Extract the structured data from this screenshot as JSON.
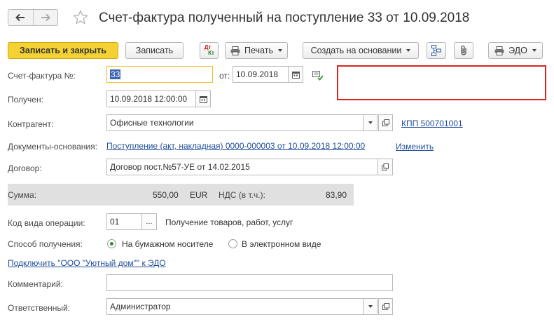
{
  "header": {
    "title": "Счет-фактура полученный на поступление 33 от 10.09.2018"
  },
  "toolbar": {
    "save_close_label": "Записать и закрыть",
    "save_label": "Записать",
    "dtkt_top": "Дт",
    "dtkt_bottom": "Кт",
    "print_label": "Печать",
    "create_based_label": "Создать на основании",
    "edo_label": "ЭДО"
  },
  "form": {
    "invoice_number_label": "Счет-фактура №:",
    "invoice_number_value": "33",
    "from_label": "от:",
    "invoice_date_value": "10.09.2018",
    "received_label": "Получен:",
    "received_value": "10.09.2018 12:00:00",
    "counterparty_label": "Контрагент:",
    "counterparty_value": "Офисные технологии",
    "kpp_link": "КПП 500701001",
    "base_docs_label": "Документы-основания:",
    "base_docs_link": "Поступление (акт, накладная) 0000-000003 от 10.09.2018 12:00:00",
    "change_link": "Изменить",
    "contract_label": "Договор:",
    "contract_value": "Договор пост.№57-УЕ от 14.02.2015",
    "sum_label": "Сумма:",
    "sum_value": "550,00",
    "currency": "EUR",
    "vat_label": "НДС (в т.ч.):",
    "vat_value": "83,90",
    "op_code_label": "Код вида операции:",
    "op_code_value": "01",
    "op_code_button": "...",
    "op_code_desc": "Получение товаров, работ, услуг",
    "receipt_method_label": "Способ получения:",
    "receipt_paper_label": "На бумажном носителе",
    "receipt_electronic_label": "В электронном виде",
    "receipt_selected": "paper",
    "connect_edo_link": "Подключить \"ООО \"Уютный дом\"\" к ЭДО",
    "comment_label": "Комментарий:",
    "comment_value": "",
    "responsible_label": "Ответственный:",
    "responsible_value": "Администратор"
  },
  "colors": {
    "primary_button": "#f5d233",
    "link": "#1f4e9c",
    "highlight_box": "#dd2222",
    "radio_dot": "#2c8a3b"
  }
}
